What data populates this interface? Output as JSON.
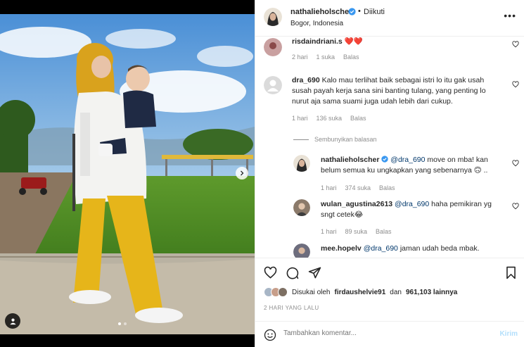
{
  "post": {
    "author": "nathalieholscher",
    "follow_status": "Diikuti",
    "location": "Bogor, Indonesia",
    "dot": "•",
    "more": "•••"
  },
  "comments": [
    {
      "user": "risdaindriani.s",
      "text": "❤️❤️",
      "time": "2 hari",
      "likes": "1 suka",
      "reply": "Balas"
    },
    {
      "user": "dra_690",
      "text": "Kalo mau terlihat baik sebagai istri lo itu gak usah susah payah kerja sana sini banting tulang, yang penting lo nurut aja sama suami juga udah lebih dari cukup.",
      "time": "1 hari",
      "likes": "136 suka",
      "reply": "Balas"
    }
  ],
  "hide_replies": "Sembunyikan balasan",
  "replies": [
    {
      "user": "nathalieholscher",
      "mention": "@dra_690",
      "text": " move on mba! kan belum semua ku ungkapkan yang sebenarnya 🙃 ..",
      "time": "1 hari",
      "likes": "374 suka",
      "reply": "Balas"
    },
    {
      "user": "wulan_agustina2613",
      "mention": "@dra_690",
      "text": " haha pemikiran yg sngt cetek😂",
      "time": "1 hari",
      "likes": "89 suka",
      "reply": "Balas"
    },
    {
      "user": "mee.hopelv",
      "mention": "@dra_690",
      "text": " jaman udah beda mbak."
    }
  ],
  "likes_line": {
    "prefix": "Disukai oleh",
    "user": "firdaushelvie91",
    "middle": "dan",
    "count": "961,103 lainnya"
  },
  "date": "2 HARI YANG LALU",
  "composer": {
    "placeholder": "Tambahkan komentar...",
    "send": "Kirim"
  },
  "icons": [
    "heart-icon",
    "comment-icon",
    "share-icon",
    "bookmark-icon",
    "verified-icon",
    "emoji-icon",
    "chevron-right-icon",
    "user-tag-icon"
  ],
  "colors": {
    "link": "#00376b",
    "verified": "#3897f0",
    "send_disabled": "#b2dffc",
    "heart": "#ed4956"
  }
}
